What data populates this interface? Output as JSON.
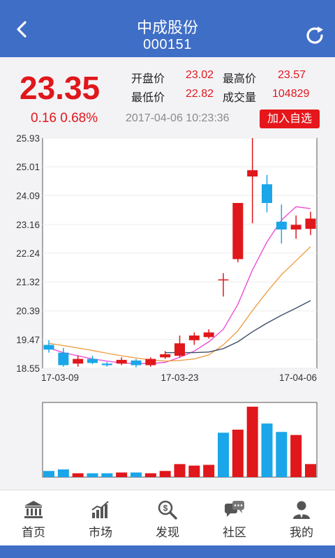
{
  "header": {
    "name": "中成股份",
    "code": "000151",
    "back_icon": "chevron-left-icon",
    "refresh_icon": "refresh-icon"
  },
  "quote": {
    "price": "23.35",
    "change": "0.16 0.68%",
    "timestamp": "2017-04-06 10:23:36",
    "open_label": "开盘价",
    "open": "23.02",
    "high_label": "最高价",
    "high": "23.57",
    "low_label": "最低价",
    "low": "22.82",
    "volume_label": "成交量",
    "volume": "104829",
    "add_watchlist": "加入自选",
    "up_color": "#e0171b"
  },
  "chart_data": [
    {
      "type": "candlestick",
      "y_ticks": [
        "25.93",
        "25.01",
        "24.09",
        "23.16",
        "22.24",
        "21.32",
        "20.39",
        "19.47",
        "18.55"
      ],
      "ylim": [
        18.55,
        25.93
      ],
      "x_tick_labels": [
        "17-03-09",
        "17-03-23",
        "17-04-06"
      ],
      "up_color": "#e0171b",
      "down_color": "#1aa6e8",
      "candles": [
        {
          "o": 19.3,
          "c": 19.15,
          "h": 19.45,
          "l": 19.05
        },
        {
          "o": 19.05,
          "c": 18.65,
          "h": 19.2,
          "l": 18.6
        },
        {
          "o": 18.7,
          "c": 18.85,
          "h": 18.95,
          "l": 18.6
        },
        {
          "o": 18.85,
          "c": 18.72,
          "h": 18.95,
          "l": 18.68
        },
        {
          "o": 18.7,
          "c": 18.65,
          "h": 18.75,
          "l": 18.6
        },
        {
          "o": 18.7,
          "c": 18.82,
          "h": 18.9,
          "l": 18.65
        },
        {
          "o": 18.8,
          "c": 18.65,
          "h": 18.85,
          "l": 18.58
        },
        {
          "o": 18.65,
          "c": 18.85,
          "h": 18.9,
          "l": 18.6
        },
        {
          "o": 18.9,
          "c": 19.0,
          "h": 19.1,
          "l": 18.85
        },
        {
          "o": 18.95,
          "c": 19.35,
          "h": 19.6,
          "l": 18.9
        },
        {
          "o": 19.45,
          "c": 19.6,
          "h": 19.7,
          "l": 19.3
        },
        {
          "o": 19.55,
          "c": 19.7,
          "h": 19.8,
          "l": 19.5
        },
        {
          "o": 21.4,
          "c": 21.4,
          "h": 21.6,
          "l": 20.85
        },
        {
          "o": 22.05,
          "c": 23.85,
          "h": 23.85,
          "l": 21.95
        },
        {
          "o": 24.7,
          "c": 24.9,
          "h": 25.93,
          "l": 23.2
        },
        {
          "o": 24.45,
          "c": 23.85,
          "h": 24.75,
          "l": 23.55
        },
        {
          "o": 23.25,
          "c": 23.0,
          "h": 23.8,
          "l": 22.55
        },
        {
          "o": 23.0,
          "c": 23.15,
          "h": 23.45,
          "l": 22.7
        },
        {
          "o": 23.02,
          "c": 23.35,
          "h": 23.57,
          "l": 22.82
        }
      ],
      "ma_series": [
        {
          "color": "#ee4fd6",
          "values": [
            19.2,
            19.05,
            18.95,
            18.85,
            18.78,
            18.72,
            18.7,
            18.7,
            18.74,
            18.9,
            19.1,
            19.4,
            19.8,
            20.6,
            21.7,
            22.6,
            23.3,
            23.73,
            23.67
          ]
        },
        {
          "color": "#f0a048",
          "values": [
            19.35,
            19.28,
            19.2,
            19.12,
            19.03,
            18.95,
            18.88,
            18.82,
            18.78,
            18.8,
            18.85,
            18.98,
            19.3,
            19.75,
            20.4,
            21.0,
            21.55,
            22.0,
            22.45
          ]
        },
        {
          "color": "#3d4d68",
          "values": [
            null,
            null,
            null,
            null,
            null,
            null,
            null,
            null,
            19.05,
            19.05,
            19.05,
            19.07,
            19.18,
            19.4,
            19.72,
            20.0,
            20.25,
            20.48,
            20.72
          ]
        }
      ]
    },
    {
      "type": "bar",
      "name_hidden": true,
      "values": [
        8,
        10,
        5,
        5,
        5,
        6,
        6,
        5,
        8,
        17,
        15,
        16,
        58,
        62,
        92,
        70,
        59,
        55,
        17
      ],
      "colors": [
        "down",
        "down",
        "up",
        "down",
        "down",
        "up",
        "down",
        "up",
        "up",
        "up",
        "up",
        "up",
        "down",
        "up",
        "up",
        "down",
        "down",
        "up",
        "up"
      ]
    }
  ],
  "tabbar": {
    "items": [
      {
        "label": "首页",
        "icon": "bank-icon"
      },
      {
        "label": "市场",
        "icon": "bar-chart-icon"
      },
      {
        "label": "发现",
        "icon": "magnifier-dollar-icon"
      },
      {
        "label": "社区",
        "icon": "chat-bubbles-icon"
      },
      {
        "label": "我的",
        "icon": "user-icon"
      }
    ]
  }
}
